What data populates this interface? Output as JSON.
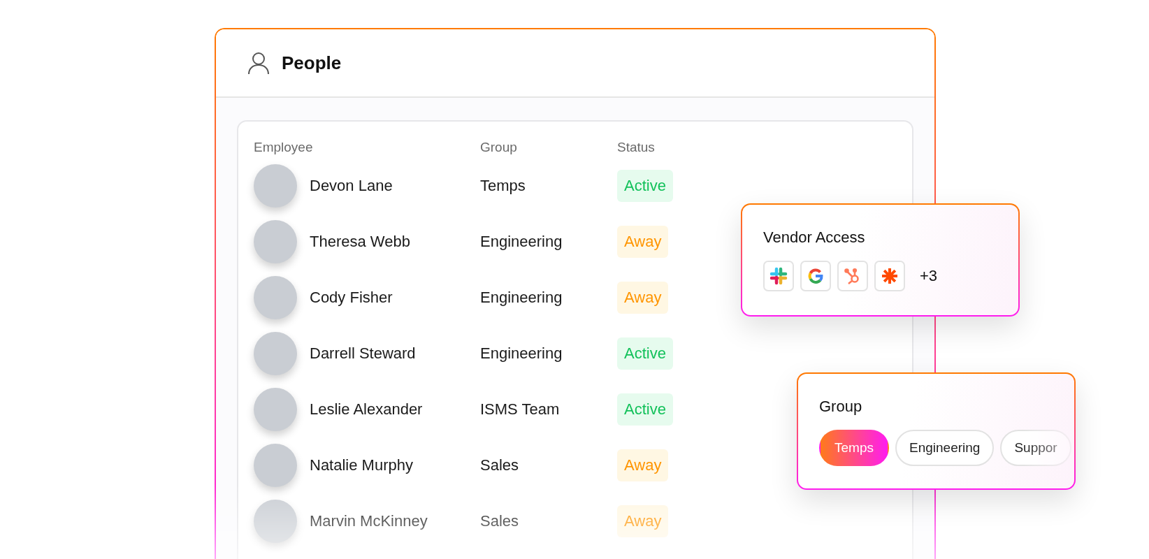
{
  "window": {
    "title": "People"
  },
  "table": {
    "columns": [
      "Employee",
      "Group",
      "Status"
    ],
    "rows": [
      {
        "name": "Devon Lane",
        "group": "Temps",
        "status": "Active",
        "kind": "active"
      },
      {
        "name": "Theresa Webb",
        "group": "Engineering",
        "status": "Away",
        "kind": "away"
      },
      {
        "name": "Cody Fisher",
        "group": "Engineering",
        "status": "Away",
        "kind": "away"
      },
      {
        "name": "Darrell Steward",
        "group": "Engineering",
        "status": "Active",
        "kind": "active"
      },
      {
        "name": "Leslie Alexander",
        "group": "ISMS Team",
        "status": "Active",
        "kind": "active"
      },
      {
        "name": "Natalie Murphy",
        "group": "Sales",
        "status": "Away",
        "kind": "away"
      },
      {
        "name": "Marvin McKinney",
        "group": "Sales",
        "status": "Away",
        "kind": "away"
      }
    ]
  },
  "vendor_access": {
    "title": "Vendor Access",
    "more_count": "+3"
  },
  "group_filter": {
    "title": "Group",
    "chips": [
      {
        "label": "Temps",
        "selected": true
      },
      {
        "label": "Engineering",
        "selected": false
      },
      {
        "label": "Suppor",
        "selected": false
      }
    ]
  }
}
